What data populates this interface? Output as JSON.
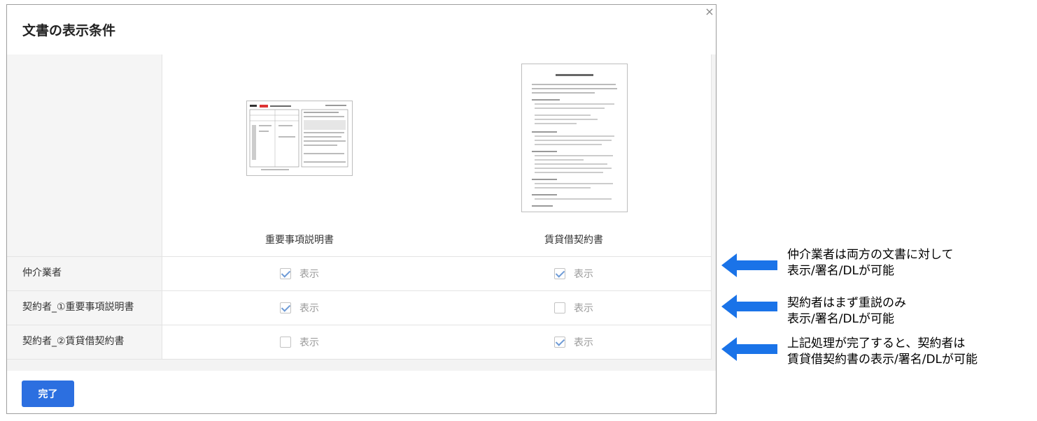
{
  "dialog": {
    "title": "文書の表示条件",
    "close_glyph": "×",
    "done_label": "完了"
  },
  "documents": [
    {
      "name": "重要事項説明書"
    },
    {
      "name": "賃貸借契約書"
    }
  ],
  "rows": [
    {
      "label": "仲介業者",
      "cells": [
        {
          "checked": true,
          "text": "表示"
        },
        {
          "checked": true,
          "text": "表示"
        }
      ]
    },
    {
      "label": "契約者_①重要事項説明書",
      "cells": [
        {
          "checked": true,
          "text": "表示"
        },
        {
          "checked": false,
          "text": "表示"
        }
      ]
    },
    {
      "label": "契約者_②賃貸借契約書",
      "cells": [
        {
          "checked": false,
          "text": "表示"
        },
        {
          "checked": true,
          "text": "表示"
        }
      ]
    }
  ],
  "annotations": [
    {
      "line1": "仲介業者は両方の文書に対して",
      "line2": "表示/署名/DLが可能"
    },
    {
      "line1": "契約者はまず重説のみ",
      "line2": "表示/署名/DLが可能"
    },
    {
      "line1": "上記処理が完了すると、契約者は",
      "line2": "賃貸借契約書の表示/署名/DLが可能"
    }
  ],
  "colors": {
    "primary": "#2c6fe0",
    "arrow": "#1a73e8",
    "check": "#6f9bd6"
  }
}
